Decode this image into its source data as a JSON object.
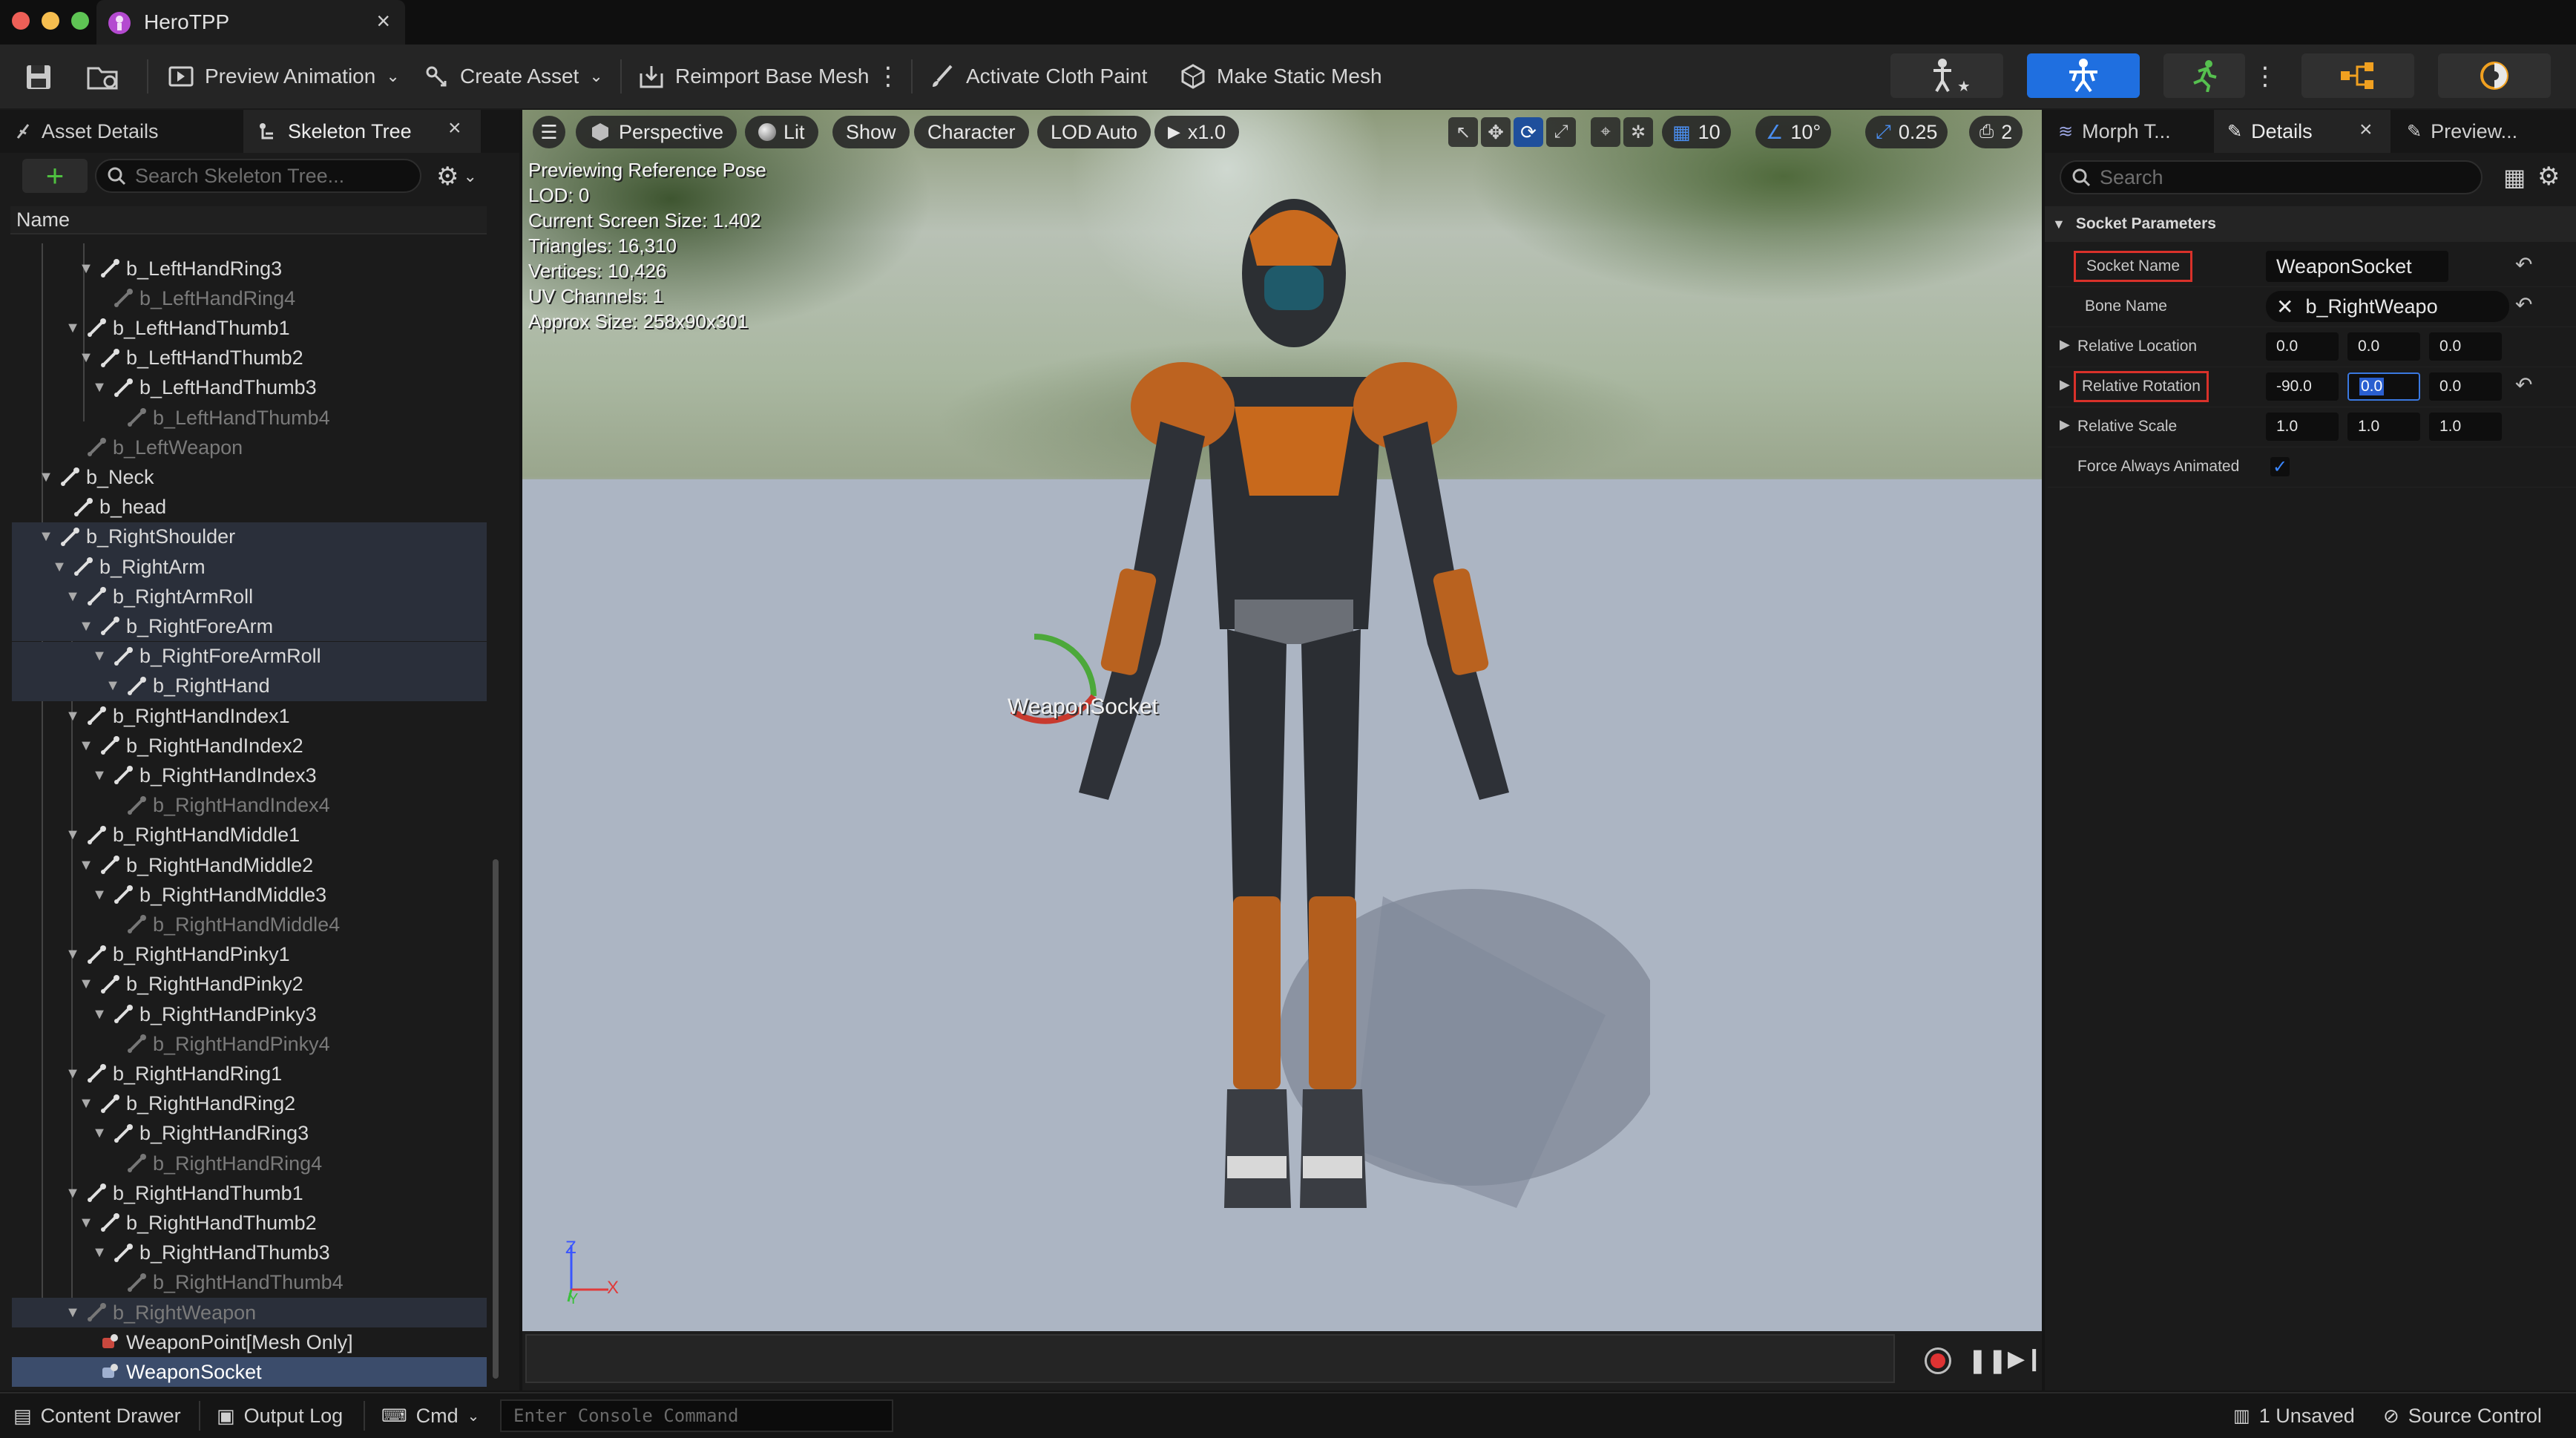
{
  "window": {
    "tab_title": "HeroTPP",
    "close_glyph": "×"
  },
  "toolbar": {
    "preview_animation": "Preview Animation",
    "create_asset": "Create Asset",
    "reimport": "Reimport Base Mesh",
    "cloth_paint": "Activate Cloth Paint",
    "static_mesh": "Make Static Mesh",
    "accent": "#1f6fe0"
  },
  "left_panel": {
    "tabs": [
      {
        "label": "Asset Details"
      },
      {
        "label": "Skeleton Tree"
      }
    ],
    "search_placeholder": "Search Skeleton Tree...",
    "column_header": "Name",
    "rows": [
      {
        "label": "b_LeftHandRing3",
        "state": "normal"
      },
      {
        "label": "b_LeftHandRing4",
        "state": "dim"
      },
      {
        "label": "b_LeftHandThumb1",
        "state": "normal"
      },
      {
        "label": "b_LeftHandThumb2",
        "state": "normal"
      },
      {
        "label": "b_LeftHandThumb3",
        "state": "normal"
      },
      {
        "label": "b_LeftHandThumb4",
        "state": "dim"
      },
      {
        "label": "b_LeftWeapon",
        "state": "dim"
      },
      {
        "label": "b_Neck",
        "state": "normal"
      },
      {
        "label": "b_head",
        "state": "normal"
      },
      {
        "label": "b_RightShoulder",
        "state": "highlight"
      },
      {
        "label": "b_RightArm",
        "state": "highlight"
      },
      {
        "label": "b_RightArmRoll",
        "state": "highlight"
      },
      {
        "label": "b_RightForeArm",
        "state": "highlight"
      },
      {
        "label": "b_RightForeArmRoll",
        "state": "highlight"
      },
      {
        "label": "b_RightHand",
        "state": "highlight"
      },
      {
        "label": "b_RightHandIndex1",
        "state": "normal"
      },
      {
        "label": "b_RightHandIndex2",
        "state": "normal"
      },
      {
        "label": "b_RightHandIndex3",
        "state": "normal"
      },
      {
        "label": "b_RightHandIndex4",
        "state": "dim"
      },
      {
        "label": "b_RightHandMiddle1",
        "state": "normal"
      },
      {
        "label": "b_RightHandMiddle2",
        "state": "normal"
      },
      {
        "label": "b_RightHandMiddle3",
        "state": "normal"
      },
      {
        "label": "b_RightHandMiddle4",
        "state": "dim"
      },
      {
        "label": "b_RightHandPinky1",
        "state": "normal"
      },
      {
        "label": "b_RightHandPinky2",
        "state": "normal"
      },
      {
        "label": "b_RightHandPinky3",
        "state": "normal"
      },
      {
        "label": "b_RightHandPinky4",
        "state": "dim"
      },
      {
        "label": "b_RightHandRing1",
        "state": "normal"
      },
      {
        "label": "b_RightHandRing2",
        "state": "normal"
      },
      {
        "label": "b_RightHandRing3",
        "state": "normal"
      },
      {
        "label": "b_RightHandRing4",
        "state": "dim"
      },
      {
        "label": "b_RightHandThumb1",
        "state": "normal"
      },
      {
        "label": "b_RightHandThumb2",
        "state": "normal"
      },
      {
        "label": "b_RightHandThumb3",
        "state": "normal"
      },
      {
        "label": "b_RightHandThumb4",
        "state": "dim"
      },
      {
        "label": "b_RightWeapon",
        "state": "dim-highlight"
      },
      {
        "label": "WeaponPoint",
        "suffix": "[Mesh Only]",
        "state": "socket"
      },
      {
        "label": "WeaponSocket",
        "state": "selected"
      }
    ]
  },
  "viewport": {
    "perspective": "Perspective",
    "lit": "Lit",
    "show": "Show",
    "character": "Character",
    "lod": "LOD Auto",
    "speed": "x1.0",
    "grid_snap": "10",
    "rot_snap": "10°",
    "scale_snap": "0.25",
    "camera_speed": "2",
    "info": [
      "Previewing Reference Pose",
      "LOD: 0",
      "Current Screen Size: 1.402",
      "Triangles: 16,310",
      "Vertices: 10,426",
      "UV Channels: 1",
      "Approx Size: 258x90x301"
    ],
    "socket_label": "WeaponSocket",
    "axis": {
      "z": "Z",
      "x": "X",
      "y": "Y"
    }
  },
  "right_panel": {
    "tabs": [
      {
        "label": "Morph T..."
      },
      {
        "label": "Details"
      },
      {
        "label": "Preview..."
      }
    ],
    "search_placeholder": "Search",
    "section": "Socket Parameters",
    "socket_name_label": "Socket Name",
    "socket_name_value": "WeaponSocket",
    "bone_name_label": "Bone Name",
    "bone_name_value": "b_RightWeapo",
    "rel_location_label": "Relative Location",
    "rel_location": [
      "0.0",
      "0.0",
      "0.0"
    ],
    "rel_rotation_label": "Relative Rotation",
    "rel_rotation": [
      "-90.0",
      "0.0",
      "0.0"
    ],
    "rel_scale_label": "Relative Scale",
    "rel_scale": [
      "1.0",
      "1.0",
      "1.0"
    ],
    "force_animated_label": "Force Always Animated",
    "force_animated": true
  },
  "statusbar": {
    "content_drawer": "Content Drawer",
    "output_log": "Output Log",
    "cmd": "Cmd",
    "console_placeholder": "Enter Console Command",
    "unsaved": "1 Unsaved",
    "source_control": "Source Control"
  }
}
